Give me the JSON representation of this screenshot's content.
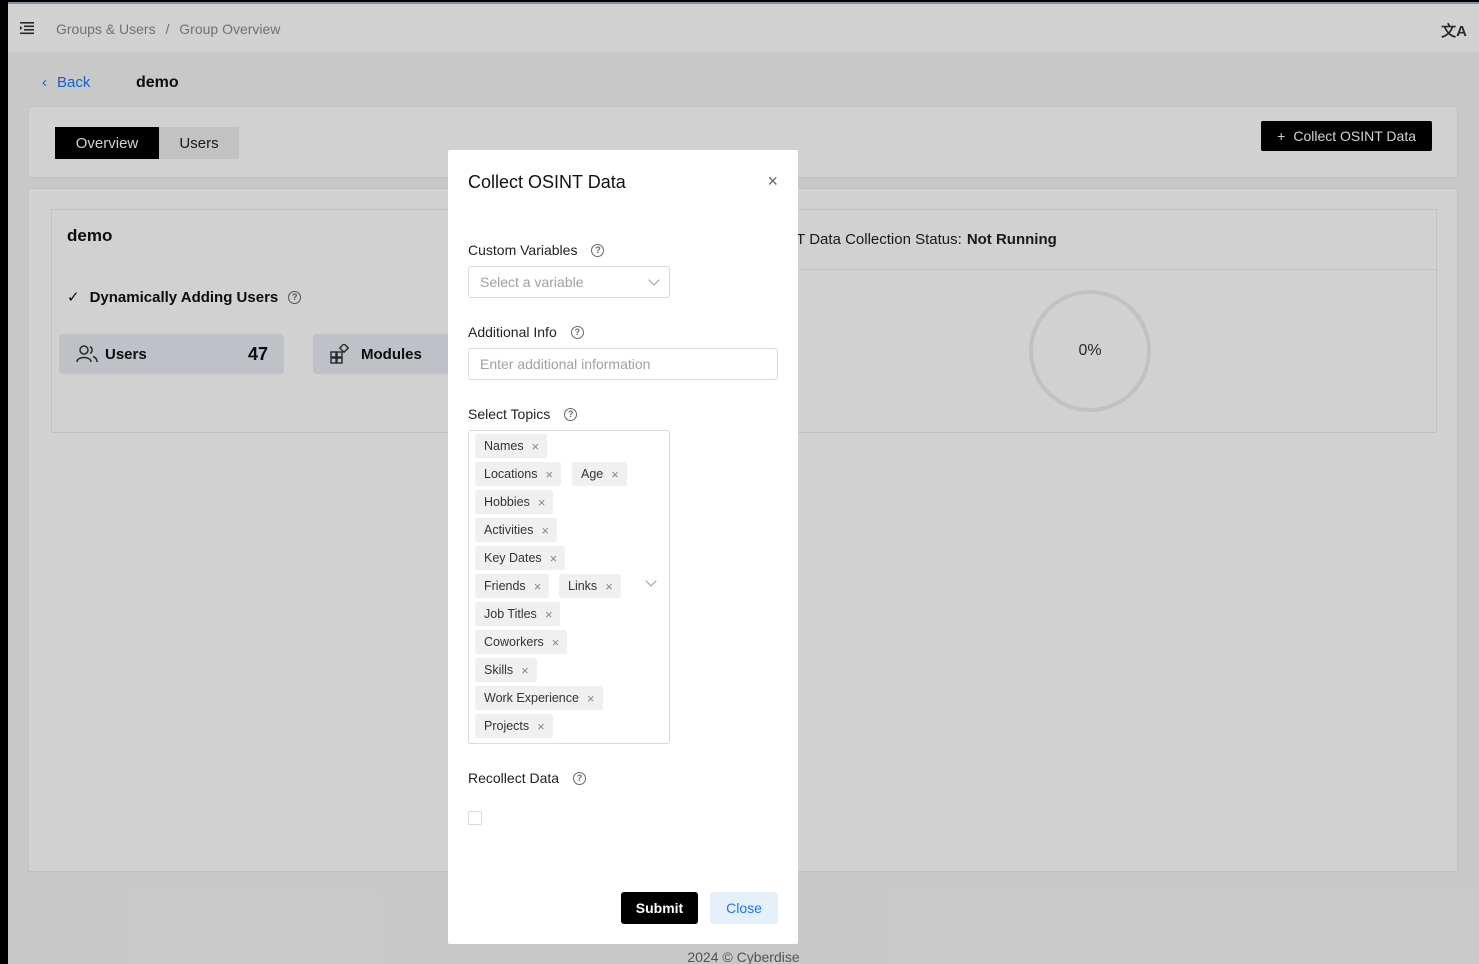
{
  "breadcrumb": {
    "parent": "Groups & Users",
    "separator": "/",
    "current": "Group Overview"
  },
  "header": {
    "translate_icon": "translate-icon",
    "translate_glyph": "文A"
  },
  "back": {
    "label": "Back"
  },
  "page": {
    "title": "demo"
  },
  "tabs": [
    {
      "label": "Overview"
    },
    {
      "label": "Users"
    }
  ],
  "actions": {
    "collect_label": "Collect OSINT Data"
  },
  "group": {
    "title": "demo",
    "dynamic_label": "Dynamically Adding Users",
    "users_label": "Users",
    "users_count": "47",
    "modules_label": "Modules"
  },
  "status": {
    "prefix": "IT Data Collection Status:",
    "value": "Not Running",
    "progress": "0%"
  },
  "footer": {
    "text": "2024 © Cyberdise"
  },
  "modal": {
    "title": "Collect OSINT Data",
    "custom_variables_label": "Custom Variables",
    "custom_variables_placeholder": "Select a variable",
    "additional_info_label": "Additional Info",
    "additional_info_placeholder": "Enter additional information",
    "topics_label": "Select Topics",
    "topics": [
      "Names",
      "Locations",
      "Age",
      "Hobbies",
      "Activities",
      "Key Dates",
      "Friends",
      "Links",
      "Job Titles",
      "Coworkers",
      "Skills",
      "Work Experience",
      "Projects"
    ],
    "recollect_label": "Recollect Data",
    "recollect_checked": false,
    "submit_label": "Submit",
    "close_label": "Close"
  }
}
